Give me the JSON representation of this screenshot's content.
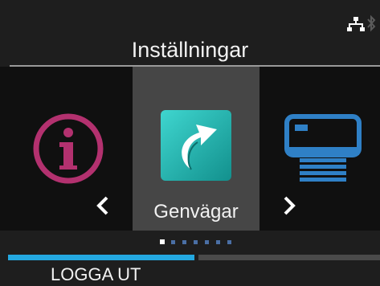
{
  "header": {
    "title": "Inställningar",
    "status_icons": [
      "network-icon",
      "bluetooth-icon"
    ]
  },
  "carousel": {
    "items": [
      {
        "icon": "info-icon",
        "label": ""
      },
      {
        "icon": "shortcut-icon",
        "label": "Genvägar"
      },
      {
        "icon": "printer-icon",
        "label": ""
      }
    ],
    "selected_index": 1,
    "prev_arrow": "‹",
    "next_arrow": "›"
  },
  "pager": {
    "total_pages": 7,
    "current_page": 1
  },
  "footer": {
    "logout_label": "LOGGA UT"
  },
  "colors": {
    "accent": "#24a8e0",
    "info_icon": "#b3316f",
    "shortcut_icon": "#1bb8b4",
    "printer_icon": "#2f80c6",
    "selected_tile": "#464646"
  }
}
